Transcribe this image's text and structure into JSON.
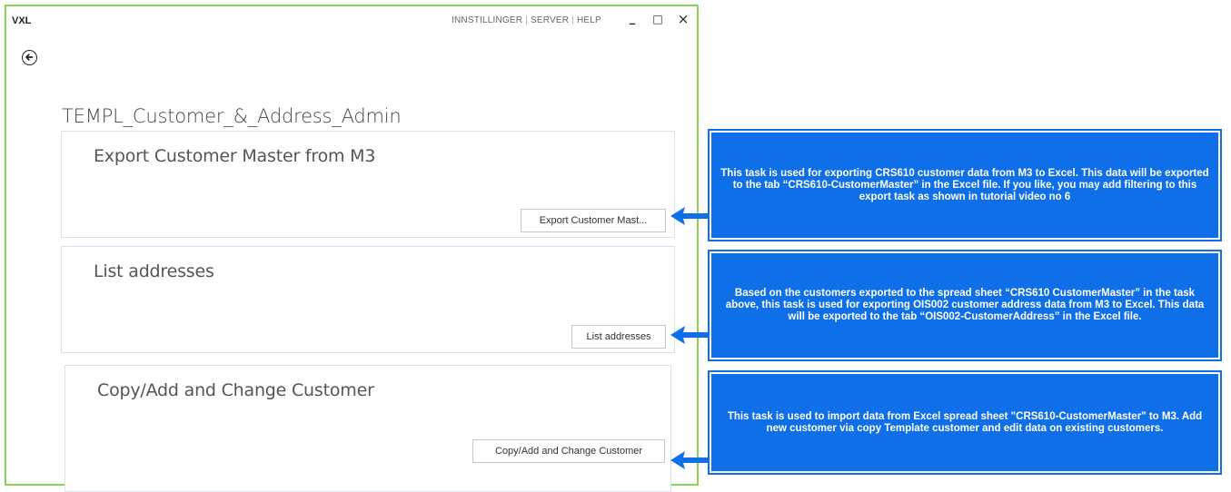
{
  "window": {
    "app_name": "VXL",
    "menu": [
      "INNSTILLINGER",
      "SERVER",
      "HELP"
    ],
    "controls": {
      "minimize": "_",
      "maximize": "□",
      "close": "×"
    }
  },
  "page": {
    "title": "TEMPL_Customer_&_Address_Admin"
  },
  "cards": [
    {
      "title": "Export Customer Master from M3",
      "button": "Export Customer Mast..."
    },
    {
      "title": "List addresses",
      "button": "List addresses"
    },
    {
      "title": "Copy/Add and Change Customer",
      "button": "Copy/Add and Change Customer"
    }
  ],
  "callouts": [
    "This task is used for exporting CRS610 customer data from M3 to Excel. This data will be exported to the tab “CRS610-CustomerMaster” in the Excel file. If you like, you may add filtering to this export task as shown in tutorial video no 6",
    "Based on the customers exported to the spread sheet “CRS610 CustomerMaster” in the task above, this task is used for exporting OIS002 customer address data from M3 to Excel. This data will be exported to the tab “OIS002-CustomerAddress” in the Excel file.",
    "This task is used to import data from Excel spread sheet \"CRS610-CustomerMaster\" to M3. Add new customer via copy Template customer and edit data on existing customers."
  ],
  "colors": {
    "window_border": "#8bd253",
    "callout": "#0f6fe8",
    "arrow": "#0f6fe8"
  },
  "icons": {
    "back": "back-arrow-icon"
  }
}
